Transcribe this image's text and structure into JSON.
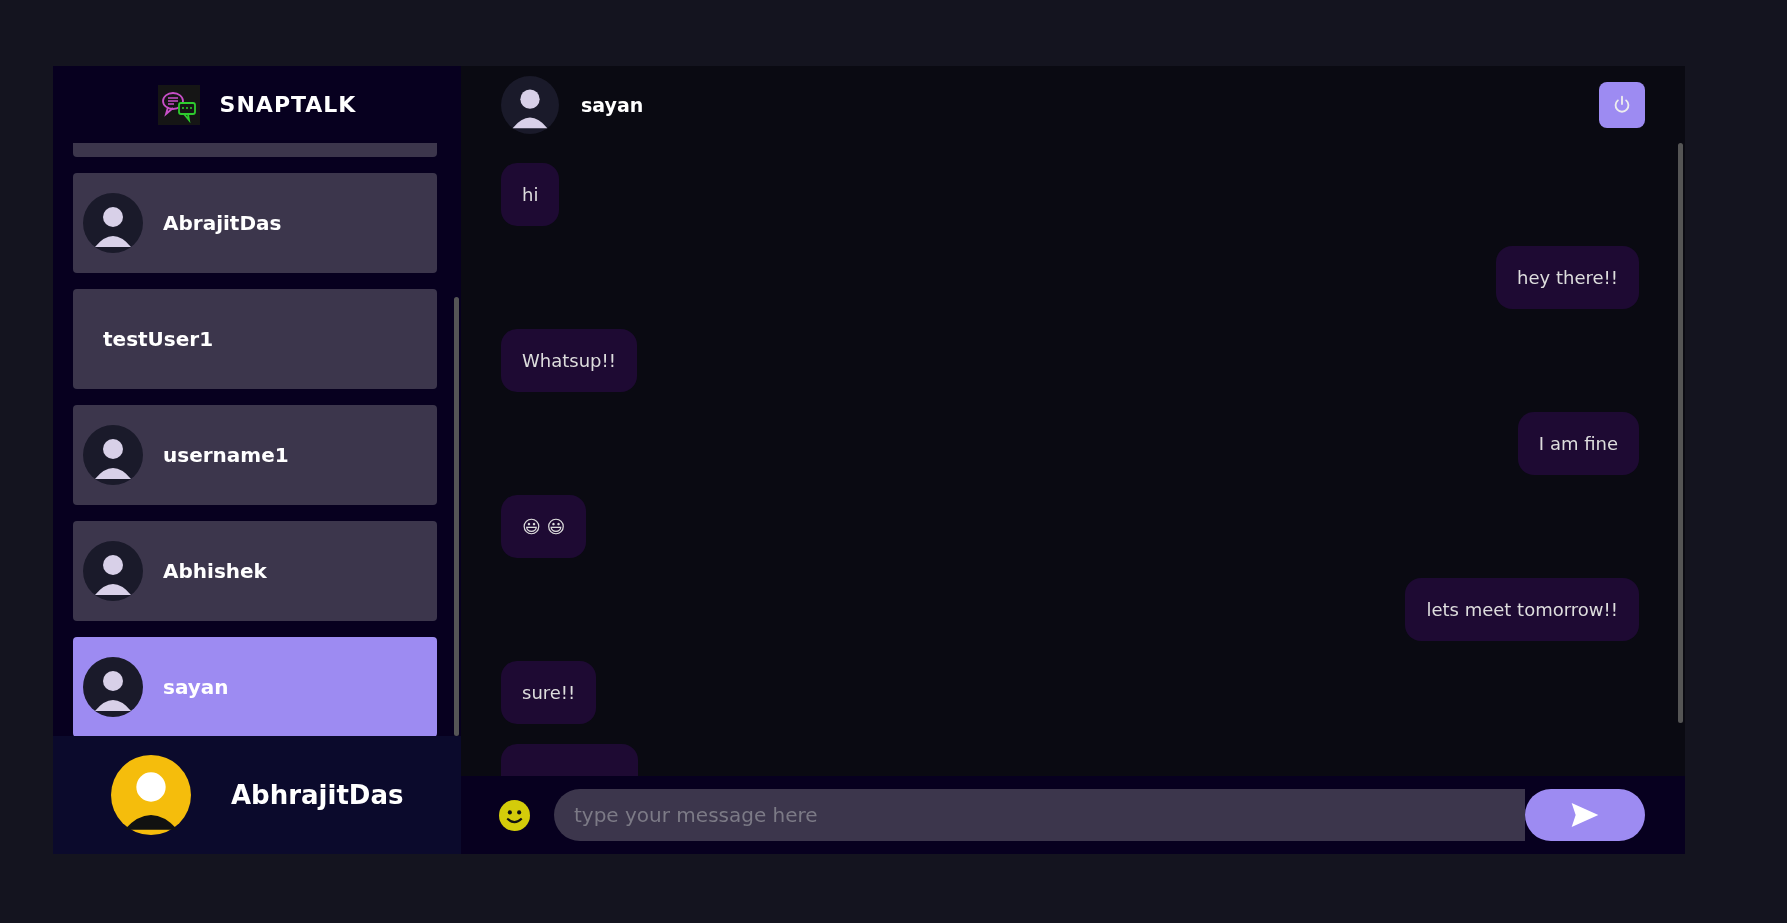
{
  "app": {
    "name": "SNAPTALK"
  },
  "contacts": [
    {
      "selected": false
    },
    {
      "name": "AbrajitDas",
      "avatar": true,
      "selected": false
    },
    {
      "name": "testUser1",
      "avatar": false,
      "selected": false
    },
    {
      "name": "username1",
      "avatar": true,
      "selected": false
    },
    {
      "name": "Abhishek",
      "avatar": true,
      "selected": false
    },
    {
      "name": "sayan",
      "avatar": true,
      "selected": true
    }
  ],
  "current_user": {
    "name": "AbhrajitDas"
  },
  "chat": {
    "name": "sayan"
  },
  "messages": [
    {
      "kind": "received",
      "text": "hi"
    },
    {
      "kind": "sent",
      "text": "hey there!!"
    },
    {
      "kind": "received",
      "text": "Whatsup!!"
    },
    {
      "kind": "sent",
      "text": "I am fine"
    },
    {
      "kind": "received",
      "text": "😃 😃"
    },
    {
      "kind": "sent",
      "text": "lets meet tomorrow!!"
    },
    {
      "kind": "received",
      "text": "sure!!"
    },
    {
      "kind": "received"
    }
  ],
  "composer": {
    "placeholder": "type your message here"
  }
}
